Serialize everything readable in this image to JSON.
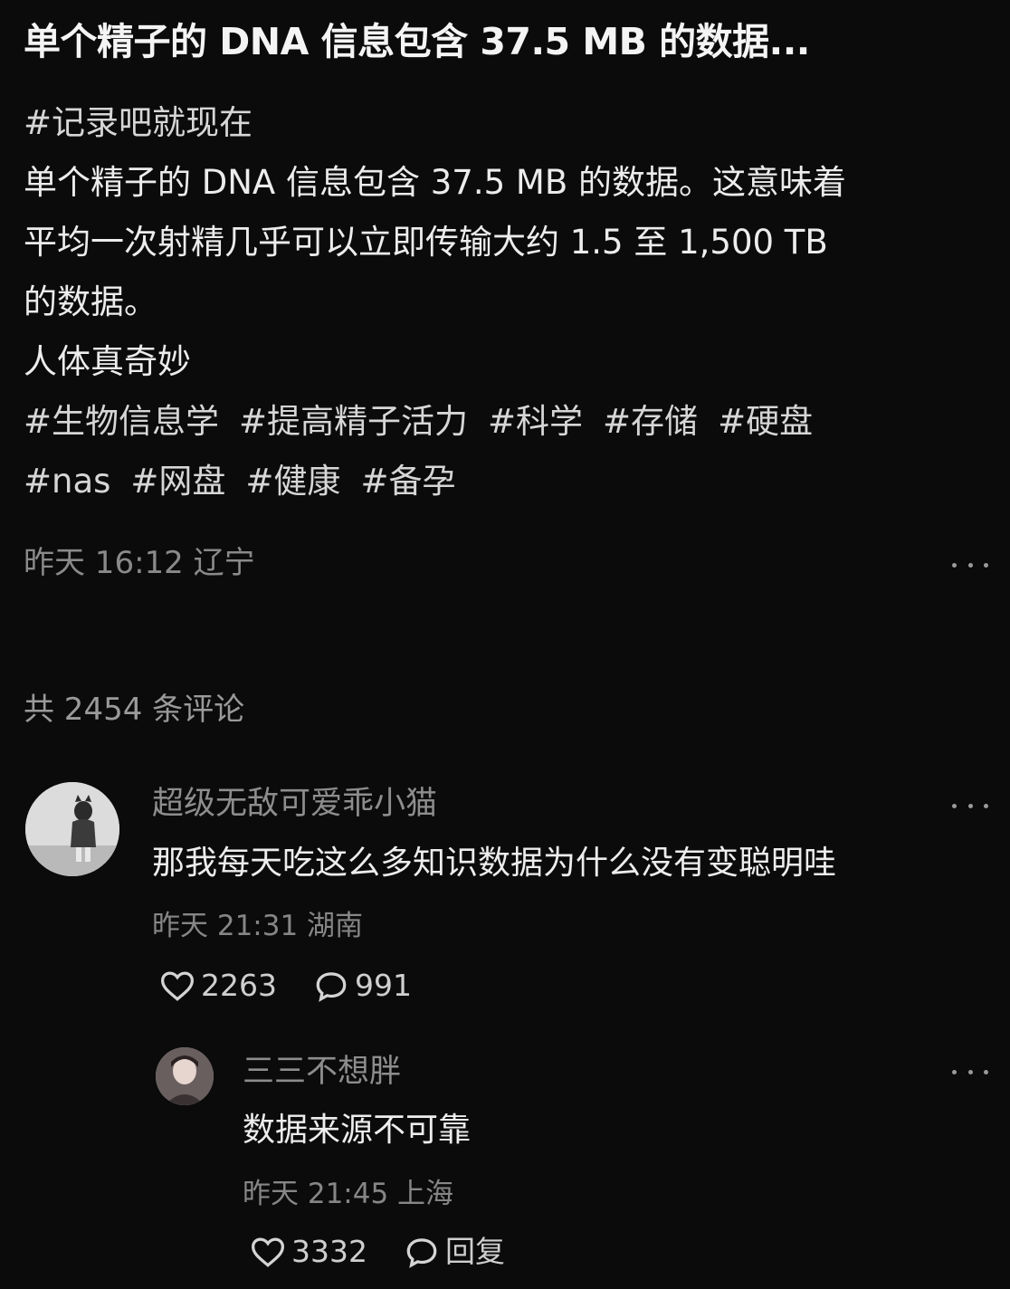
{
  "post": {
    "title": "单个精子的 DNA 信息包含 37.5 MB 的数据...",
    "top_tag": "#记录吧就现在",
    "body_lines": [
      "单个精子的 DNA 信息包含 37.5 MB 的数据。这意味着",
      "平均一次射精几乎可以立即传输大约 1.5 至 1,500 TB",
      "的数据。",
      "人体真奇妙"
    ],
    "tags": [
      "#生物信息学",
      "#提高精子活力",
      "#科学",
      "#存储",
      "#硬盘",
      "#nas",
      "#网盘",
      "#健康",
      "#备孕"
    ],
    "meta": "昨天 16:12 辽宁"
  },
  "comments_header": {
    "label": "共 2454 条评论"
  },
  "comments": [
    {
      "username": "超级无敌可爱乖小猫",
      "text": "那我每天吃这么多知识数据为什么没有变聪明哇",
      "meta": "昨天 21:31 湖南",
      "likes": "2263",
      "replies": "991",
      "avatar_icon": "figure-avatar-icon",
      "like_icon": "heart-outline-icon",
      "reply_icon": "chat-bubble-icon"
    },
    {
      "username": "三三不想胖",
      "text": "数据来源不可靠",
      "meta": "昨天 21:45 上海",
      "likes": "3332",
      "reply_label": "回复",
      "avatar_icon": "portrait-avatar-icon",
      "like_icon": "heart-outline-icon",
      "reply_icon": "chat-bubble-icon"
    }
  ],
  "colors": {
    "background": "#0b0b0b",
    "primary_text": "#ececec",
    "secondary_text": "#8a8a8a"
  }
}
